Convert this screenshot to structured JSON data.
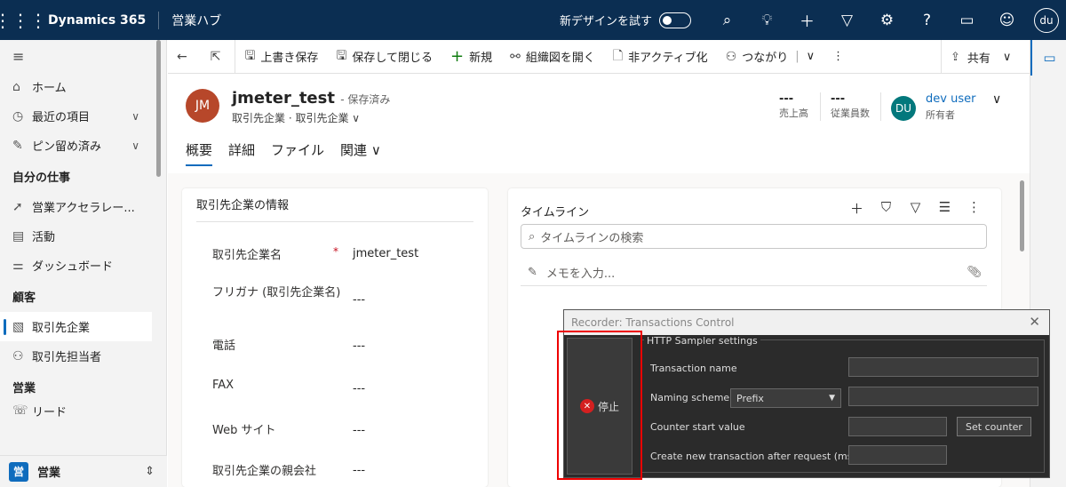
{
  "topbar": {
    "brand": "Dynamics 365",
    "hub": "営業ハブ",
    "try_new": "新デザインを試す",
    "user_initials": "du"
  },
  "sidebar": {
    "items": [
      {
        "label": "ホーム",
        "icon": "home-icon"
      },
      {
        "label": "最近の項目",
        "icon": "clock-icon"
      },
      {
        "label": "ピン留め済み",
        "icon": "pin-icon"
      }
    ],
    "group_mywork": "自分の仕事",
    "mywork": [
      {
        "label": "営業アクセラレー...",
        "icon": "rocket-icon"
      },
      {
        "label": "活動",
        "icon": "clipboard-icon"
      },
      {
        "label": "ダッシュボード",
        "icon": "dashboard-icon"
      }
    ],
    "group_customers": "顧客",
    "customers": [
      {
        "label": "取引先企業",
        "icon": "building-icon"
      },
      {
        "label": "取引先担当者",
        "icon": "person-icon"
      }
    ],
    "group_sales": "営業",
    "sales_partial": "リード",
    "area_badge": "営",
    "area_label": "営業"
  },
  "commandbar": {
    "save": "上書き保存",
    "save_close": "保存して閉じる",
    "new": "新規",
    "org_chart": "組織図を開く",
    "deactivate": "非アクティブ化",
    "connect": "つながり",
    "share": "共有"
  },
  "record": {
    "initials": "JM",
    "name": "jmeter_test",
    "saved_status": "- 保存済み",
    "entity": "取引先企業 · 取引先企業",
    "kpi_revenue_value": "---",
    "kpi_revenue_label": "売上高",
    "kpi_employees_value": "---",
    "kpi_employees_label": "従業員数",
    "owner_initials": "DU",
    "owner_name": "dev user",
    "owner_role": "所有者",
    "tabs": [
      "概要",
      "詳細",
      "ファイル",
      "関連"
    ]
  },
  "account_info": {
    "title": "取引先企業の情報",
    "fields": [
      {
        "label": "取引先企業名",
        "value": "jmeter_test",
        "required": "*"
      },
      {
        "label": "フリガナ (取引先企業名)",
        "value": "---"
      },
      {
        "label": "電話",
        "value": "---"
      },
      {
        "label": "FAX",
        "value": "---"
      },
      {
        "label": "Web サイト",
        "value": "---"
      },
      {
        "label": "取引先企業の親会社",
        "value": "---"
      }
    ]
  },
  "timeline": {
    "title": "タイムライン",
    "search_placeholder": "タイムラインの検索",
    "note_placeholder": "メモを入力..."
  },
  "recorder": {
    "title": "Recorder: Transactions Control",
    "stop_label": "停止",
    "group_label": "HTTP Sampler settings",
    "transaction_name": "Transaction name",
    "naming_scheme": "Naming scheme",
    "naming_value": "Prefix",
    "counter_start": "Counter start value",
    "set_counter": "Set counter",
    "create_after": "Create new transaction after request (ms):"
  }
}
